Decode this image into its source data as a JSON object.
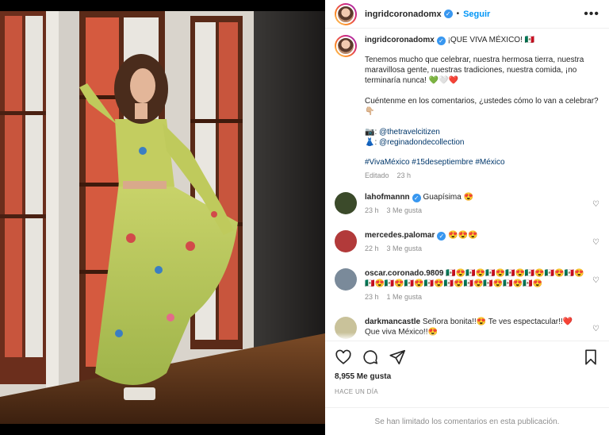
{
  "post": {
    "author": "ingridcoronadomx",
    "follow_label": "Seguir",
    "more_label": "•••",
    "dot": "•"
  },
  "caption": {
    "author": "ingridcoronadomx",
    "title": "¡QUE VIVA MÉXICO! 🇲🇽",
    "p1": "Tenemos mucho que celebrar, nuestra hermosa tierra, nuestra maravillosa gente, nuestras tradiciones, nuestra comida, ¡no terminaría nunca! 💚🤍❤️",
    "p2": "Cuéntenme en los comentarios, ¿ustedes cómo lo van a celebrar? 👇🏼",
    "credit1_icon": "📷",
    "credit1": "@thetravelcitizen",
    "credit2_icon": "👗",
    "credit2": "@reginadondecollection",
    "tags": "#VivaMéxico #15deseptiembre #México",
    "edited": "Editado",
    "time": "23 h"
  },
  "comments": [
    {
      "user": "lahofmannn",
      "verified": true,
      "text": "Guapísima 😍",
      "time": "23 h",
      "likes": "3 Me gusta",
      "avatar_color": "#3b4a2a"
    },
    {
      "user": "mercedes.palomar",
      "verified": true,
      "text": "😍😍😍",
      "time": "22 h",
      "likes": "3 Me gusta",
      "avatar_color": "#b23a3a"
    },
    {
      "user": "oscar.coronado.9809",
      "verified": false,
      "text": "🇲🇽😍🇲🇽😍🇲🇽😍🇲🇽😍🇲🇽😍🇲🇽😍🇲🇽😍🇲🇽😍🇲🇽😍🇲🇽😍🇲🇽😍🇲🇽😍🇲🇽😍🇲🇽😍🇲🇽😍🇲🇽😍",
      "time": "23 h",
      "likes": "1 Me gusta",
      "avatar_color": "#7a8a9a"
    },
    {
      "user": "darkmancastle",
      "verified": false,
      "text": "Señora bonita!!😍 Te ves espectacular!!❤️ Que viva México!!😍",
      "time": "",
      "likes": "",
      "avatar_color": "#c9c29a"
    }
  ],
  "footer": {
    "likes": "8,955 Me gusta",
    "date": "Hace un día",
    "limited": "Se han limitado los comentarios en esta publicación."
  },
  "icons": {
    "like": "heart-icon",
    "comment": "comment-icon",
    "share": "send-icon",
    "save": "bookmark-icon"
  }
}
